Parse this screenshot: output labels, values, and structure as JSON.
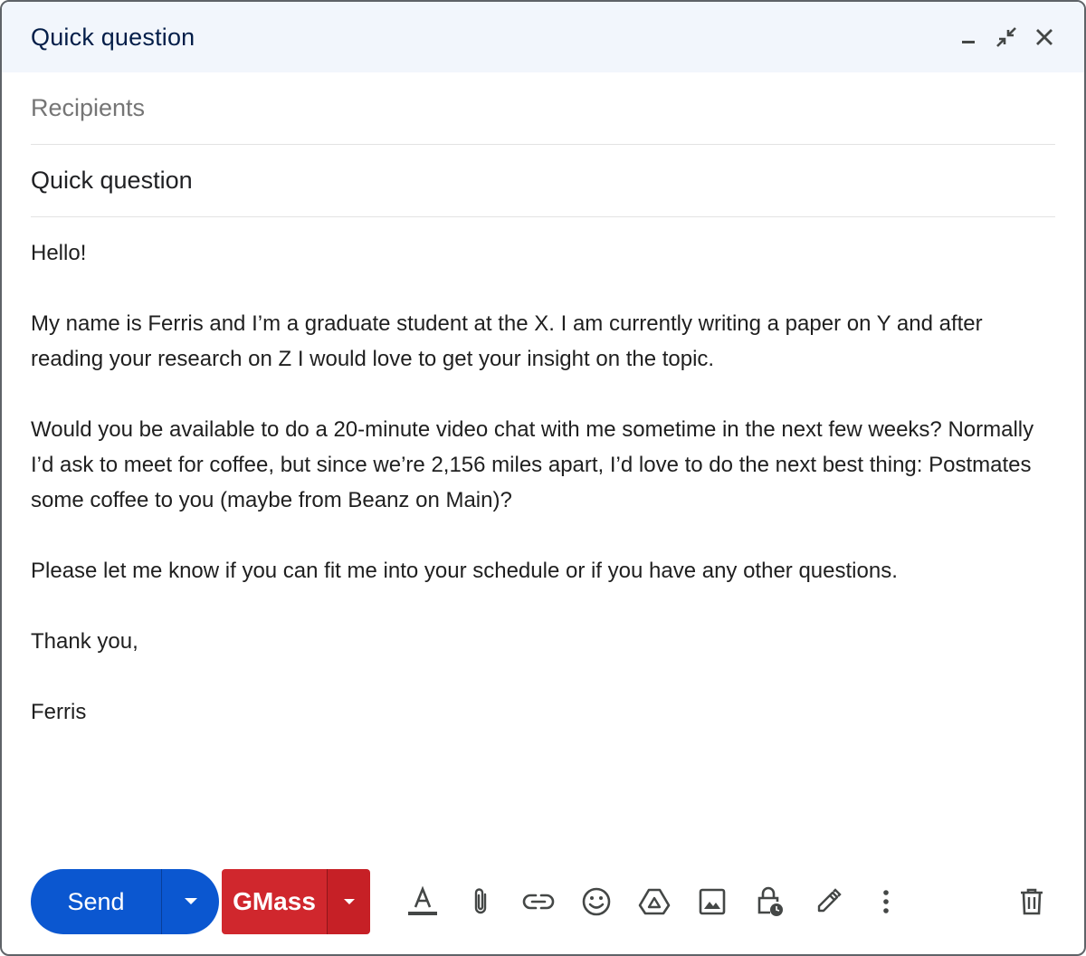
{
  "window": {
    "title": "Quick question"
  },
  "recipients": {
    "placeholder": "Recipients",
    "value": ""
  },
  "subject": {
    "value": "Quick question"
  },
  "body": {
    "paragraphs": [
      "Hello!",
      "My name is Ferris and I’m a graduate student at the X. I am currently writing a paper on Y and after reading your research on Z I would love to get your insight on the topic.",
      "Would you be available to do a 20-minute video chat with me sometime in the next few weeks? Normally I’d ask to meet for coffee, but since we’re 2,156 miles apart, I’d love to do the next best thing: Postmates some coffee to you (maybe from Beanz on Main)?",
      "Please let me know if you can fit me into your schedule or if you have any other questions.",
      "Thank you,",
      "Ferris"
    ]
  },
  "toolbar": {
    "send_label": "Send",
    "gmass_label": "GMass",
    "icons": [
      "format-text-icon",
      "attach-icon",
      "link-icon",
      "emoji-icon",
      "drive-icon",
      "photo-icon",
      "confidential-icon",
      "signature-icon",
      "more-options-icon",
      "trash-icon"
    ]
  },
  "colors": {
    "send": "#0b57d0",
    "gmass": "#d0272d",
    "header_bg": "#f2f6fc"
  }
}
